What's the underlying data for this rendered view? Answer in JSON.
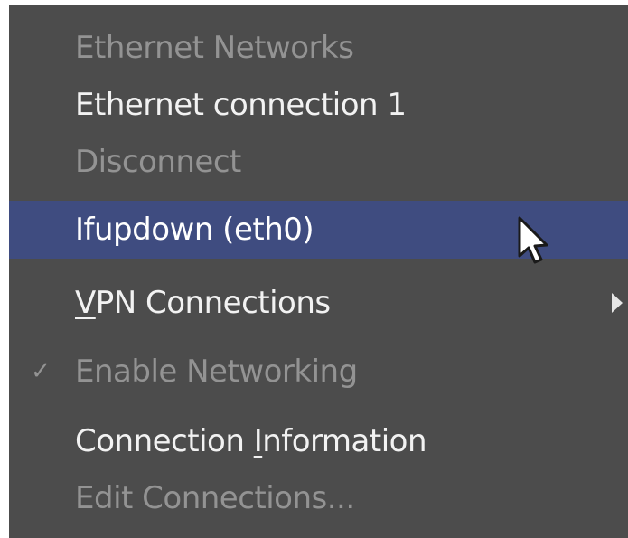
{
  "menu": {
    "section_header": "Ethernet Networks",
    "ethernet_connection": "Ethernet connection 1",
    "disconnect": "Disconnect",
    "ifupdown": "Ifupdown (eth0)",
    "vpn": {
      "mnemonic": "V",
      "rest": "PN Connections"
    },
    "enable_networking": {
      "checked": true,
      "check_glyph": "✓",
      "label": "Enable Networking"
    },
    "connection_info": {
      "before": "Connection ",
      "mnemonic": "I",
      "after": "nformation"
    },
    "edit_connections": "Edit Connections..."
  },
  "colors": {
    "menu_bg": "#4c4c4c",
    "highlight_bg": "#3f4c80",
    "disabled_text": "#939393",
    "enabled_text": "#f2f2f2"
  },
  "icons": {
    "submenu": "chevron-right-icon",
    "check": "check-icon",
    "pointer": "mouse-pointer-icon"
  }
}
